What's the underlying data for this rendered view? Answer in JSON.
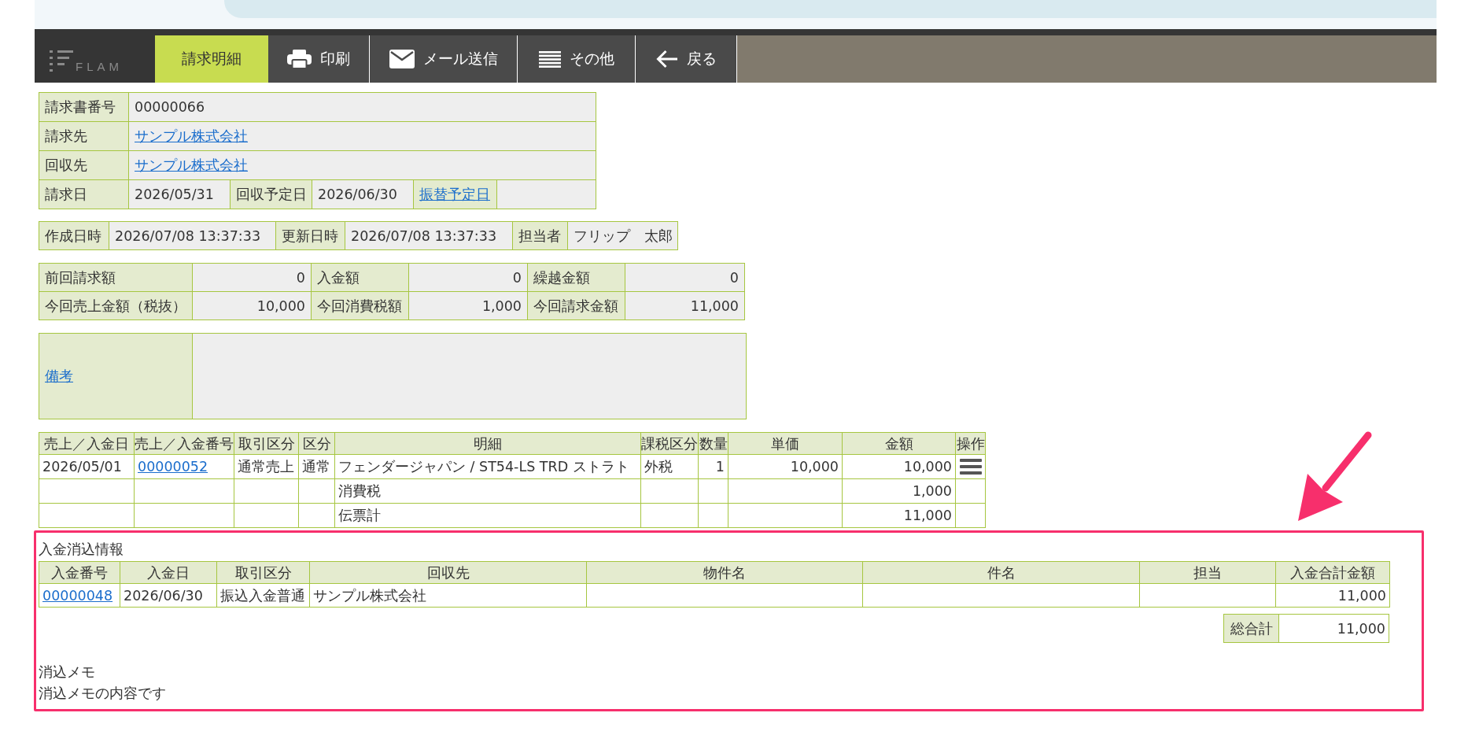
{
  "nav": {
    "logo": "FLAM",
    "items": [
      {
        "kind": "tab",
        "label": "請求明細",
        "selected": true
      },
      {
        "kind": "print",
        "label": "印刷",
        "selected": false
      },
      {
        "kind": "mail",
        "label": "メール送信",
        "selected": false
      },
      {
        "kind": "more",
        "label": "その他",
        "selected": false
      },
      {
        "kind": "back",
        "label": "戻る",
        "selected": false
      }
    ]
  },
  "invoice": [
    [
      {
        "kind": "label",
        "text": "請求書番号"
      },
      {
        "kind": "value",
        "text": "00000066"
      }
    ],
    [
      {
        "kind": "label",
        "text": "請求先"
      },
      {
        "kind": "link",
        "text": "サンプル株式会社"
      }
    ],
    [
      {
        "kind": "label",
        "text": "回収先"
      },
      {
        "kind": "link",
        "text": "サンプル株式会社"
      }
    ],
    [
      {
        "kind": "label",
        "text": "請求日"
      },
      {
        "kind": "value",
        "text": "2026/05/31"
      },
      {
        "kind": "label",
        "text": "回収予定日"
      },
      {
        "kind": "value",
        "text": "2026/06/30"
      },
      {
        "kind": "label_link",
        "text": "振替予定日"
      }
    ]
  ],
  "record": [
    {
      "kind": "label",
      "text": "作成日時"
    },
    {
      "kind": "value",
      "text": "2026/07/08 13:37:33"
    },
    {
      "kind": "label",
      "text": "更新日時"
    },
    {
      "kind": "value",
      "text": "2026/07/08 13:37:33"
    },
    {
      "kind": "label",
      "text": "担当者"
    },
    {
      "kind": "value",
      "text": "フリップ　太郎"
    }
  ],
  "amounts": [
    [
      {
        "label": "前回請求額",
        "value": "0"
      },
      {
        "label": "入金額",
        "value": "0"
      },
      {
        "label": "繰越金額",
        "value": "0"
      }
    ],
    [
      {
        "label": "今回売上金額（税抜）",
        "value": "10,000"
      },
      {
        "label": "今回消費税額",
        "value": "1,000"
      },
      {
        "label": "今回請求金額",
        "value": "11,000"
      }
    ]
  ],
  "remarks": {
    "label": "備考"
  },
  "lines": {
    "columns": [
      "売上／入金日",
      "売上／入金番号",
      "取引区分",
      "区分",
      "明細",
      "課税区分",
      "数量",
      "単価",
      "金額",
      "操作"
    ],
    "rows": [
      {
        "date": "2026/05/01",
        "number": "00000052",
        "trade_type": "通常売上",
        "category": "通常",
        "detail": "フェンダージャパン / ST54-LS TRD ストラト",
        "tax_type": "外税",
        "quantity": "1",
        "unit_price": "10,000",
        "amount": "10,000",
        "menu": true
      },
      {
        "detail": "消費税",
        "amount": "1,000",
        "menu": false
      },
      {
        "detail": "伝票計",
        "amount": "11,000",
        "menu": false
      }
    ]
  },
  "payment": {
    "highlighted": true,
    "title": "入金消込情報",
    "columns": [
      "入金番号",
      "入金日",
      "取引区分",
      "回収先",
      "物件名",
      "件名",
      "担当",
      "入金合計金額"
    ],
    "rows": [
      {
        "number": "00000048",
        "date": "2026/06/30",
        "trade_type": "振込入金普通",
        "payer": "サンプル株式会社",
        "amount": "11,000"
      }
    ],
    "total": {
      "label": "総合計",
      "value": "11,000"
    },
    "memo_label": "消込メモ",
    "memo": "消込メモの内容です"
  },
  "annotations": [
    {
      "kind": "arrow"
    }
  ]
}
